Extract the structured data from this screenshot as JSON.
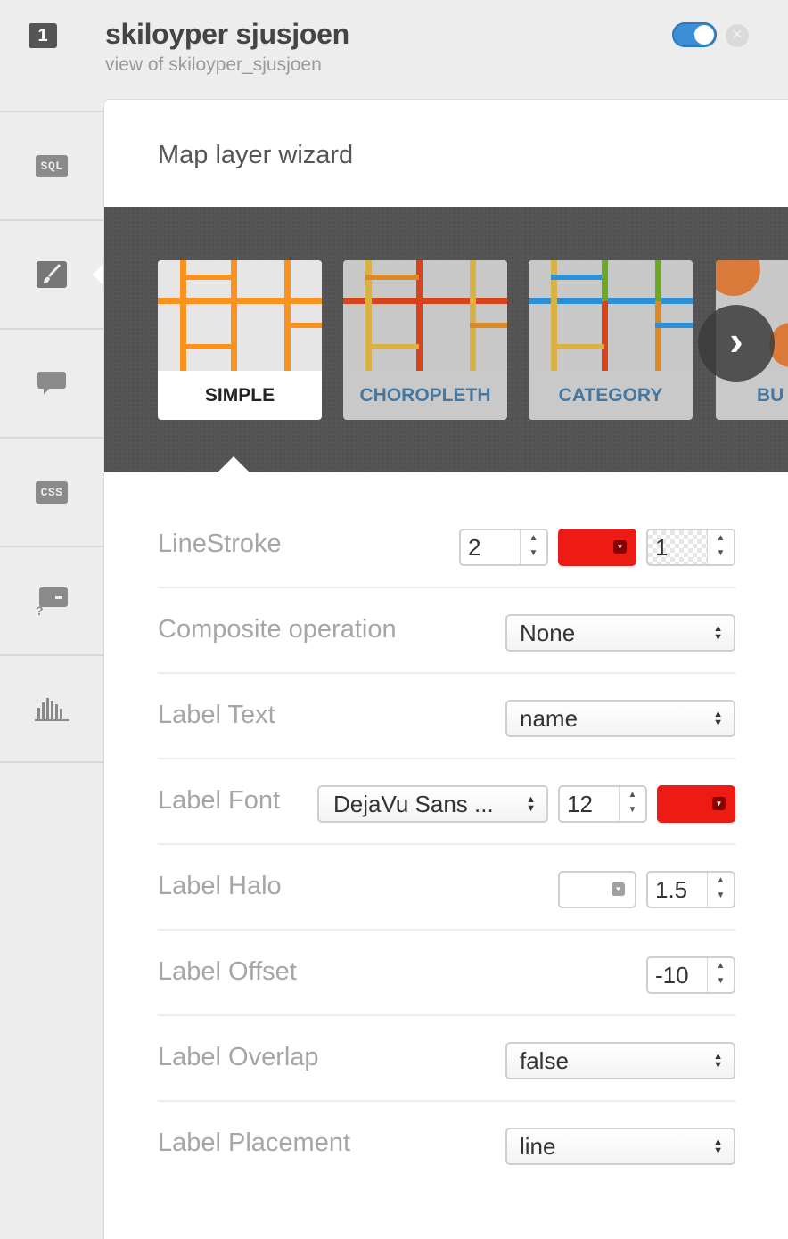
{
  "header": {
    "layer_number": "1",
    "title": "skiloyper sjusjoen",
    "subtitle": "view of skiloyper_sjusjoen",
    "visible_toggle": "on",
    "close_glyph": "×"
  },
  "sidebar": {
    "items": [
      {
        "name": "sql",
        "label": "SQL",
        "icon": "sql-icon"
      },
      {
        "name": "wizard",
        "icon": "paintbrush-icon",
        "active": true
      },
      {
        "name": "infowindow",
        "icon": "speech-bubble-icon"
      },
      {
        "name": "css",
        "label": "CSS",
        "icon": "css-icon"
      },
      {
        "name": "legends",
        "icon": "legend-icon"
      },
      {
        "name": "filters",
        "icon": "bar-chart-icon"
      }
    ]
  },
  "wizard": {
    "title": "Map layer wizard",
    "cards": [
      {
        "label": "SIMPLE",
        "active": true
      },
      {
        "label": "CHOROPLETH",
        "active": false
      },
      {
        "label": "CATEGORY",
        "active": false
      },
      {
        "label": "BU",
        "active": false
      }
    ],
    "next_glyph": "›"
  },
  "form": {
    "line_stroke": {
      "label": "LineStroke",
      "width": "2",
      "color": "#ee1b14",
      "opacity": "1"
    },
    "composite": {
      "label": "Composite operation",
      "value": "None"
    },
    "label_text": {
      "label": "Label Text",
      "value": "name"
    },
    "label_font": {
      "label": "Label Font",
      "family": "DejaVu Sans ...",
      "size": "12",
      "color": "#ee1b14"
    },
    "label_halo": {
      "label": "Label Halo",
      "color": "#ffffff",
      "size": "1.5"
    },
    "label_offset": {
      "label": "Label Offset",
      "value": "-10"
    },
    "label_overlap": {
      "label": "Label Overlap",
      "value": "false"
    },
    "label_placement": {
      "label": "Label Placement",
      "value": "line"
    }
  },
  "colors": {
    "accent": "#3d8fd6",
    "swatch_red": "#ee1b14",
    "simple_orange": "#f7931e"
  }
}
